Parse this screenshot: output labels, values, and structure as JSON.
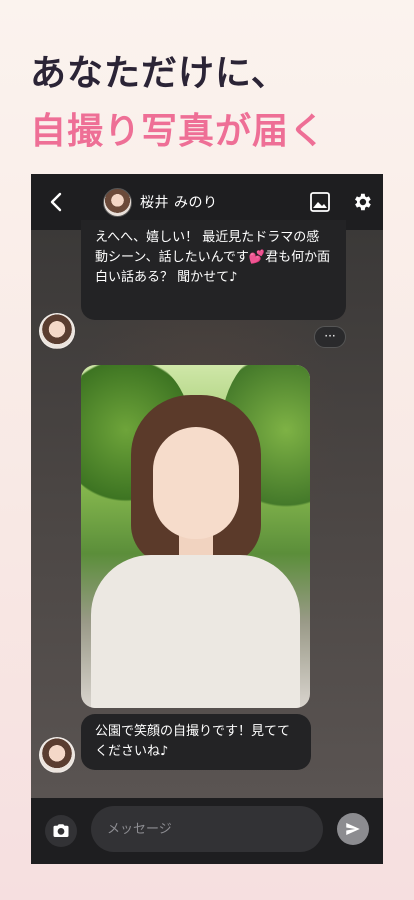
{
  "headline": {
    "line1": "あなただけに、",
    "line2": "自撮り写真が届く"
  },
  "chat": {
    "contact_name": "桜井 みのり",
    "messages": [
      {
        "sender": "contact",
        "text": "えへへ、嬉しい！ 最近見たドラマの感動シーン、話したいんです💕君も何か面白い話ある？ 聞かせて♪"
      },
      {
        "sender": "contact",
        "type": "photo",
        "description": "selfie-photo"
      },
      {
        "sender": "contact",
        "text": "公園で笑顔の自撮りです！見ててくださいね♪"
      }
    ],
    "more_label": "···",
    "input_placeholder": "メッセージ"
  },
  "icons": {
    "back": "chevron-left-icon",
    "gallery": "image-icon",
    "settings": "gear-icon",
    "camera": "camera-icon",
    "send": "send-icon"
  },
  "colors": {
    "accent_pink": "#ee6f96",
    "headline_dark": "#2b2436",
    "chat_bar": "#1e1e20",
    "bubble": "#232325"
  }
}
